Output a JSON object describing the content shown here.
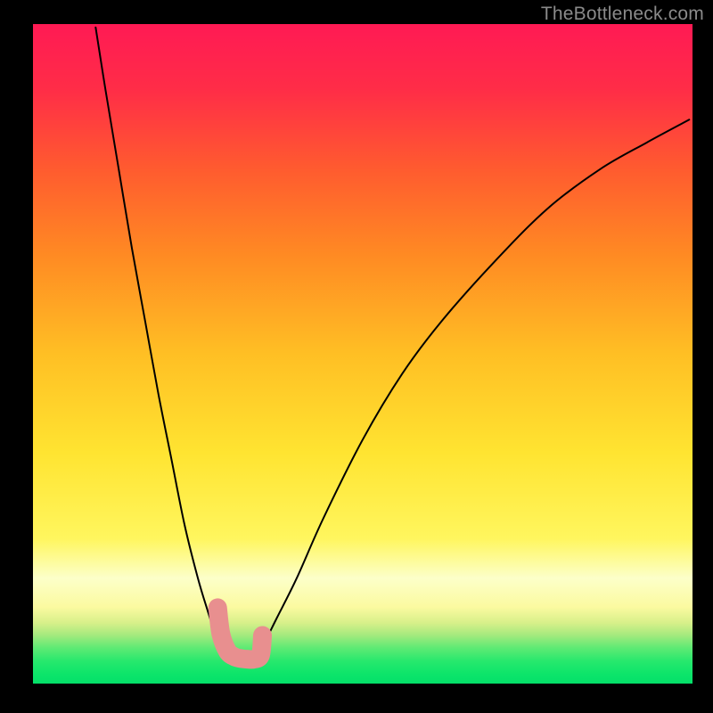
{
  "watermark": "TheBottleneck.com",
  "chart_data": {
    "type": "line",
    "title": "",
    "xlabel": "",
    "ylabel": "",
    "xlim": [
      0,
      100
    ],
    "ylim": [
      0,
      100
    ],
    "grid": false,
    "background_gradient_stops": [
      {
        "pos": 0.0,
        "color": "#ff1a54"
      },
      {
        "pos": 0.1,
        "color": "#ff2d47"
      },
      {
        "pos": 0.22,
        "color": "#ff5b2f"
      },
      {
        "pos": 0.35,
        "color": "#ff8a23"
      },
      {
        "pos": 0.5,
        "color": "#ffbf24"
      },
      {
        "pos": 0.65,
        "color": "#ffe431"
      },
      {
        "pos": 0.78,
        "color": "#fff65e"
      },
      {
        "pos": 0.84,
        "color": "#fcffc9"
      },
      {
        "pos": 0.884,
        "color": "#fbfaa0"
      },
      {
        "pos": 0.908,
        "color": "#d7f08a"
      },
      {
        "pos": 0.926,
        "color": "#a6ea7e"
      },
      {
        "pos": 0.946,
        "color": "#5eea74"
      },
      {
        "pos": 0.966,
        "color": "#27e86d"
      },
      {
        "pos": 0.985,
        "color": "#0de56a"
      },
      {
        "pos": 1.0,
        "color": "#04e069"
      }
    ],
    "series": [
      {
        "name": "left-curve",
        "color": "#000000",
        "x": [
          9.5,
          11,
          13,
          15,
          17,
          19,
          21,
          23,
          25,
          26.5,
          27.5,
          28.5,
          29.3,
          30.0
        ],
        "y": [
          99.5,
          90,
          78,
          66,
          55,
          44,
          34,
          24,
          16,
          11,
          8,
          6,
          4.8,
          4.2
        ]
      },
      {
        "name": "right-curve",
        "color": "#000000",
        "x": [
          34,
          35,
          37,
          40,
          44,
          50,
          56,
          62,
          70,
          78,
          86,
          93,
          99.5
        ],
        "y": [
          4.2,
          6,
          10,
          16,
          25,
          37,
          47,
          55,
          64,
          72,
          78,
          82,
          85.5
        ]
      },
      {
        "name": "highlight-band",
        "color": "#e88f8f",
        "note": "thick rounded marker over valley",
        "x": [
          28.0,
          28.5,
          29.5,
          30.5,
          31.5,
          32.5,
          33.5,
          34.5,
          34.8
        ],
        "y": [
          11.5,
          7.5,
          4.9,
          4.1,
          3.8,
          3.7,
          3.7,
          4.3,
          7.3
        ]
      }
    ]
  }
}
